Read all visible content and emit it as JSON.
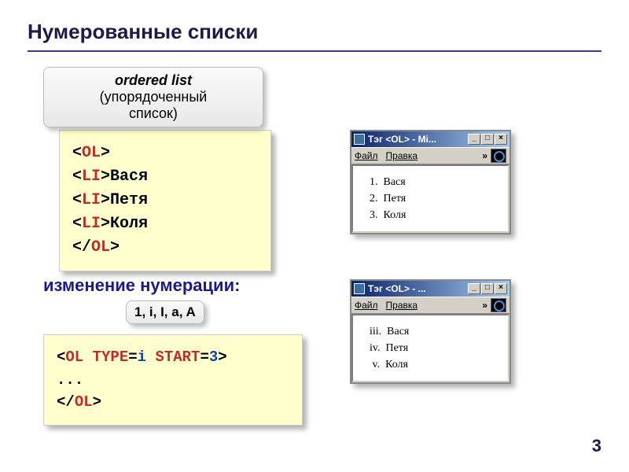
{
  "title": "Нумерованные списки",
  "callout1_line1": "ordered list",
  "callout1_line2": "(упорядоченный",
  "callout1_line3": "список)",
  "code1": {
    "l1a": "<",
    "l1b": "OL",
    "l1c": ">",
    "l2a": "<",
    "l2b": "LI",
    "l2c": ">Вася",
    "l3a": "<",
    "l3b": "LI",
    "l3c": ">Петя",
    "l4a": "<",
    "l4b": "LI",
    "l4c": ">Коля",
    "l5a": "</",
    "l5b": "OL",
    "l5c": ">"
  },
  "subtitle": "изменение нумерации:",
  "callout2": "1, i, I, a, A",
  "code2": {
    "l1a": "<",
    "l1b": "OL",
    "l1c": " ",
    "l1d": "TYPE",
    "l1e": "=",
    "l1f": "i",
    "l1g": " ",
    "l1h": "START",
    "l1i": "=",
    "l1j": "3",
    "l1k": ">",
    "l2": "...",
    "l3a": "</",
    "l3b": "OL",
    "l3c": ">"
  },
  "window": {
    "title1": "Тэг <OL> - Mi...",
    "title2": "Тэг <OL> - ...",
    "menu1": "Файл",
    "menu2": "Правка",
    "chev": "»",
    "min": "_",
    "max": "□",
    "close": "×"
  },
  "output1": {
    "r1": "  1.  Вася",
    "r2": "  2.  Петя",
    "r3": "  3.  Коля"
  },
  "output2": {
    "r1": "  iii.  Вася",
    "r2": "  iv.  Петя",
    "r3": "   v.  Коля"
  },
  "page": "3"
}
